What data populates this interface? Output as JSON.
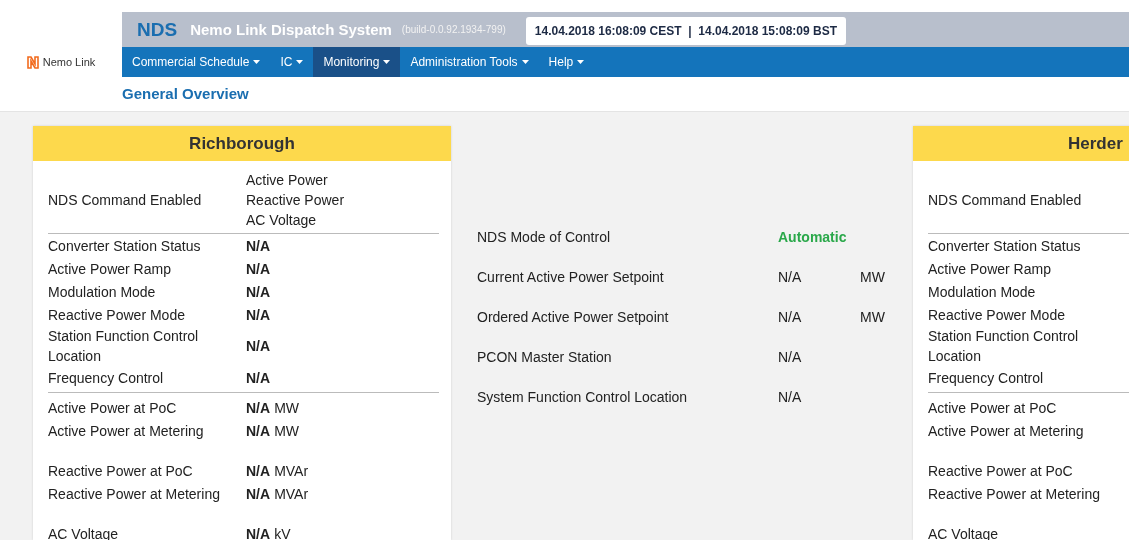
{
  "logo": {
    "text": "Nemo Link"
  },
  "header": {
    "short_title": "NDS",
    "title": "Nemo Link Dispatch System",
    "build": "(build-0.0.92.1934-799)",
    "clock": "14.04.2018 16:08:09 CEST  |  14.04.2018 15:08:09 BST"
  },
  "nav": [
    {
      "label": "Commercial Schedule",
      "selected": false
    },
    {
      "label": "IC",
      "selected": false
    },
    {
      "label": "Monitoring",
      "selected": true
    },
    {
      "label": "Administration Tools",
      "selected": false
    },
    {
      "label": "Help",
      "selected": false
    }
  ],
  "page_title": "General Overview",
  "stations": [
    {
      "name": "Richborough",
      "command_label": "NDS Command Enabled",
      "command_values": [
        "Active Power",
        "Reactive Power",
        "AC Voltage"
      ],
      "status_rows": [
        {
          "label": "Converter Station Status",
          "value": "N/A"
        },
        {
          "label": "Active Power Ramp",
          "value": "N/A"
        },
        {
          "label": "Modulation Mode",
          "value": "N/A"
        },
        {
          "label": "Reactive Power Mode",
          "value": "N/A"
        },
        {
          "label": "Station Function Control Location",
          "value": "N/A"
        },
        {
          "label": "Frequency Control",
          "value": "N/A"
        }
      ],
      "measurement_groups": [
        [
          {
            "label": "Active Power at PoC",
            "value": "N/A",
            "unit": "MW"
          },
          {
            "label": "Active Power at Metering",
            "value": "N/A",
            "unit": "MW"
          }
        ],
        [
          {
            "label": "Reactive Power at PoC",
            "value": "N/A",
            "unit": "MVAr"
          },
          {
            "label": "Reactive Power at Metering",
            "value": "N/A",
            "unit": "MVAr"
          }
        ],
        [
          {
            "label": "AC Voltage",
            "value": "N/A",
            "unit": "kV"
          }
        ]
      ]
    },
    {
      "name": "Herder",
      "command_label": "NDS Command Enabled",
      "status_rows": [
        {
          "label": "Converter Station Status"
        },
        {
          "label": "Active Power Ramp"
        },
        {
          "label": "Modulation Mode"
        },
        {
          "label": "Reactive Power Mode"
        },
        {
          "label": "Station Function Control Location"
        },
        {
          "label": "Frequency Control"
        }
      ],
      "measurement_groups": [
        [
          {
            "label": "Active Power at PoC"
          },
          {
            "label": "Active Power at Metering"
          }
        ],
        [
          {
            "label": "Reactive Power at PoC"
          },
          {
            "label": "Reactive Power at Metering"
          }
        ],
        [
          {
            "label": "AC Voltage"
          }
        ]
      ]
    }
  ],
  "control": [
    {
      "label": "NDS Mode of Control",
      "value": "Automatic",
      "kind": "status"
    },
    {
      "label": "Current Active Power Setpoint",
      "value": "N/A",
      "unit": "MW",
      "kind": "plain"
    },
    {
      "label": "Ordered Active Power Setpoint",
      "value": "N/A",
      "unit": "MW",
      "kind": "plain"
    },
    {
      "label": "PCON Master Station",
      "value": "N/A",
      "kind": "plain"
    },
    {
      "label": "System Function Control Location",
      "value": "N/A",
      "kind": "plain"
    }
  ]
}
